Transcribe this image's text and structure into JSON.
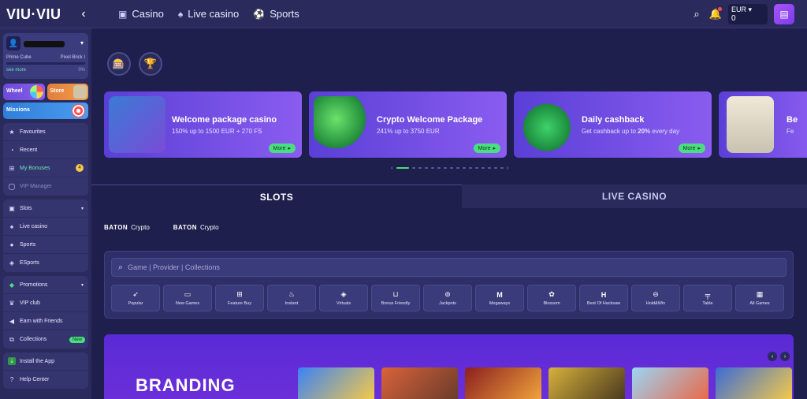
{
  "header": {
    "logo": "VIU·VIU",
    "collapse_icon": "chevron-left-icon",
    "nav": [
      {
        "label": "Casino",
        "icon": "slot-icon"
      },
      {
        "label": "Live casino",
        "icon": "live-icon"
      },
      {
        "label": "Sports",
        "icon": "ball-icon"
      }
    ],
    "wallet": {
      "currency": "EUR",
      "balance": "0"
    }
  },
  "sidebar": {
    "profile": {
      "rank": "Prime Cube",
      "next_rank": "Pixel Brick I",
      "see_more": "see more",
      "progress": "0%"
    },
    "tiles": {
      "wheel": "Wheel",
      "store": "Store",
      "missions": "Missions"
    },
    "group1": [
      {
        "label": "Favourites",
        "icon": "star-icon"
      },
      {
        "label": "Recent",
        "icon": "clock-icon"
      },
      {
        "label": "My Bonuses",
        "icon": "gift-icon",
        "badge": "4"
      },
      {
        "label": "VIP Manager",
        "icon": "whatsapp-icon"
      }
    ],
    "group2": [
      {
        "label": "Slots",
        "icon": "slot-icon"
      },
      {
        "label": "Live casino",
        "icon": "live-icon"
      },
      {
        "label": "Sports",
        "icon": "ball-icon"
      },
      {
        "label": "ESports",
        "icon": "gamepad-icon"
      }
    ],
    "group3": [
      {
        "label": "Promotions",
        "icon": "tag-icon"
      },
      {
        "label": "VIP club",
        "icon": "crown-icon"
      },
      {
        "label": "Earn with Friends",
        "icon": "megaphone-icon"
      },
      {
        "label": "Collections",
        "icon": "collection-icon",
        "badge": "New"
      }
    ],
    "group4": [
      {
        "label": "Install the App",
        "icon": "download-icon"
      },
      {
        "label": "Help Center",
        "icon": "help-icon"
      }
    ]
  },
  "banners": [
    {
      "title": "Welcome package casino",
      "subtitle": "150% up to 1500 EUR + 270 FS",
      "more": "More"
    },
    {
      "title": "Crypto Welcome Package",
      "subtitle": "241% up to 3750 EUR",
      "more": "More"
    },
    {
      "title": "Daily cashback",
      "subtitle_pre": "Get cashback up to ",
      "subtitle_bold": "20%",
      "subtitle_post": " every day",
      "more": "More"
    },
    {
      "title": "Be",
      "subtitle": "Fe"
    }
  ],
  "tabs": {
    "slots": "SLOTS",
    "live": "LIVE CASINO"
  },
  "sponsors": [
    {
      "mark": "BATON",
      "label": "Crypto"
    },
    {
      "mark": "BATON",
      "label": "Crypto"
    }
  ],
  "search": {
    "placeholder": "Game | Provider | Collections"
  },
  "categories": [
    {
      "label": "Popular",
      "icon": "rocket-icon"
    },
    {
      "label": "New Games",
      "icon": "new-icon"
    },
    {
      "label": "Feature Buy",
      "icon": "gift-icon"
    },
    {
      "label": "Instant",
      "icon": "flame-icon"
    },
    {
      "label": "Virtuals",
      "icon": "gamepad-icon"
    },
    {
      "label": "Bonus Friendly",
      "icon": "cart-icon"
    },
    {
      "label": "Jackpots",
      "icon": "jackpot-icon"
    },
    {
      "label": "Megaways",
      "icon": "megaways-icon"
    },
    {
      "label": "Blossom",
      "icon": "blossom-icon"
    },
    {
      "label": "Best Of Hacksaw",
      "icon": "hacksaw-icon"
    },
    {
      "label": "Hold&Win",
      "icon": "holdwin-icon"
    },
    {
      "label": "Table",
      "icon": "table-icon"
    },
    {
      "label": "All Games",
      "icon": "grid-icon"
    }
  ],
  "branding": {
    "title": "BRANDING"
  },
  "colors": {
    "accent_green": "#4ade80",
    "bg": "#1e1f4d",
    "panel": "#2a2b5c",
    "purple": "#8a5cf0"
  }
}
